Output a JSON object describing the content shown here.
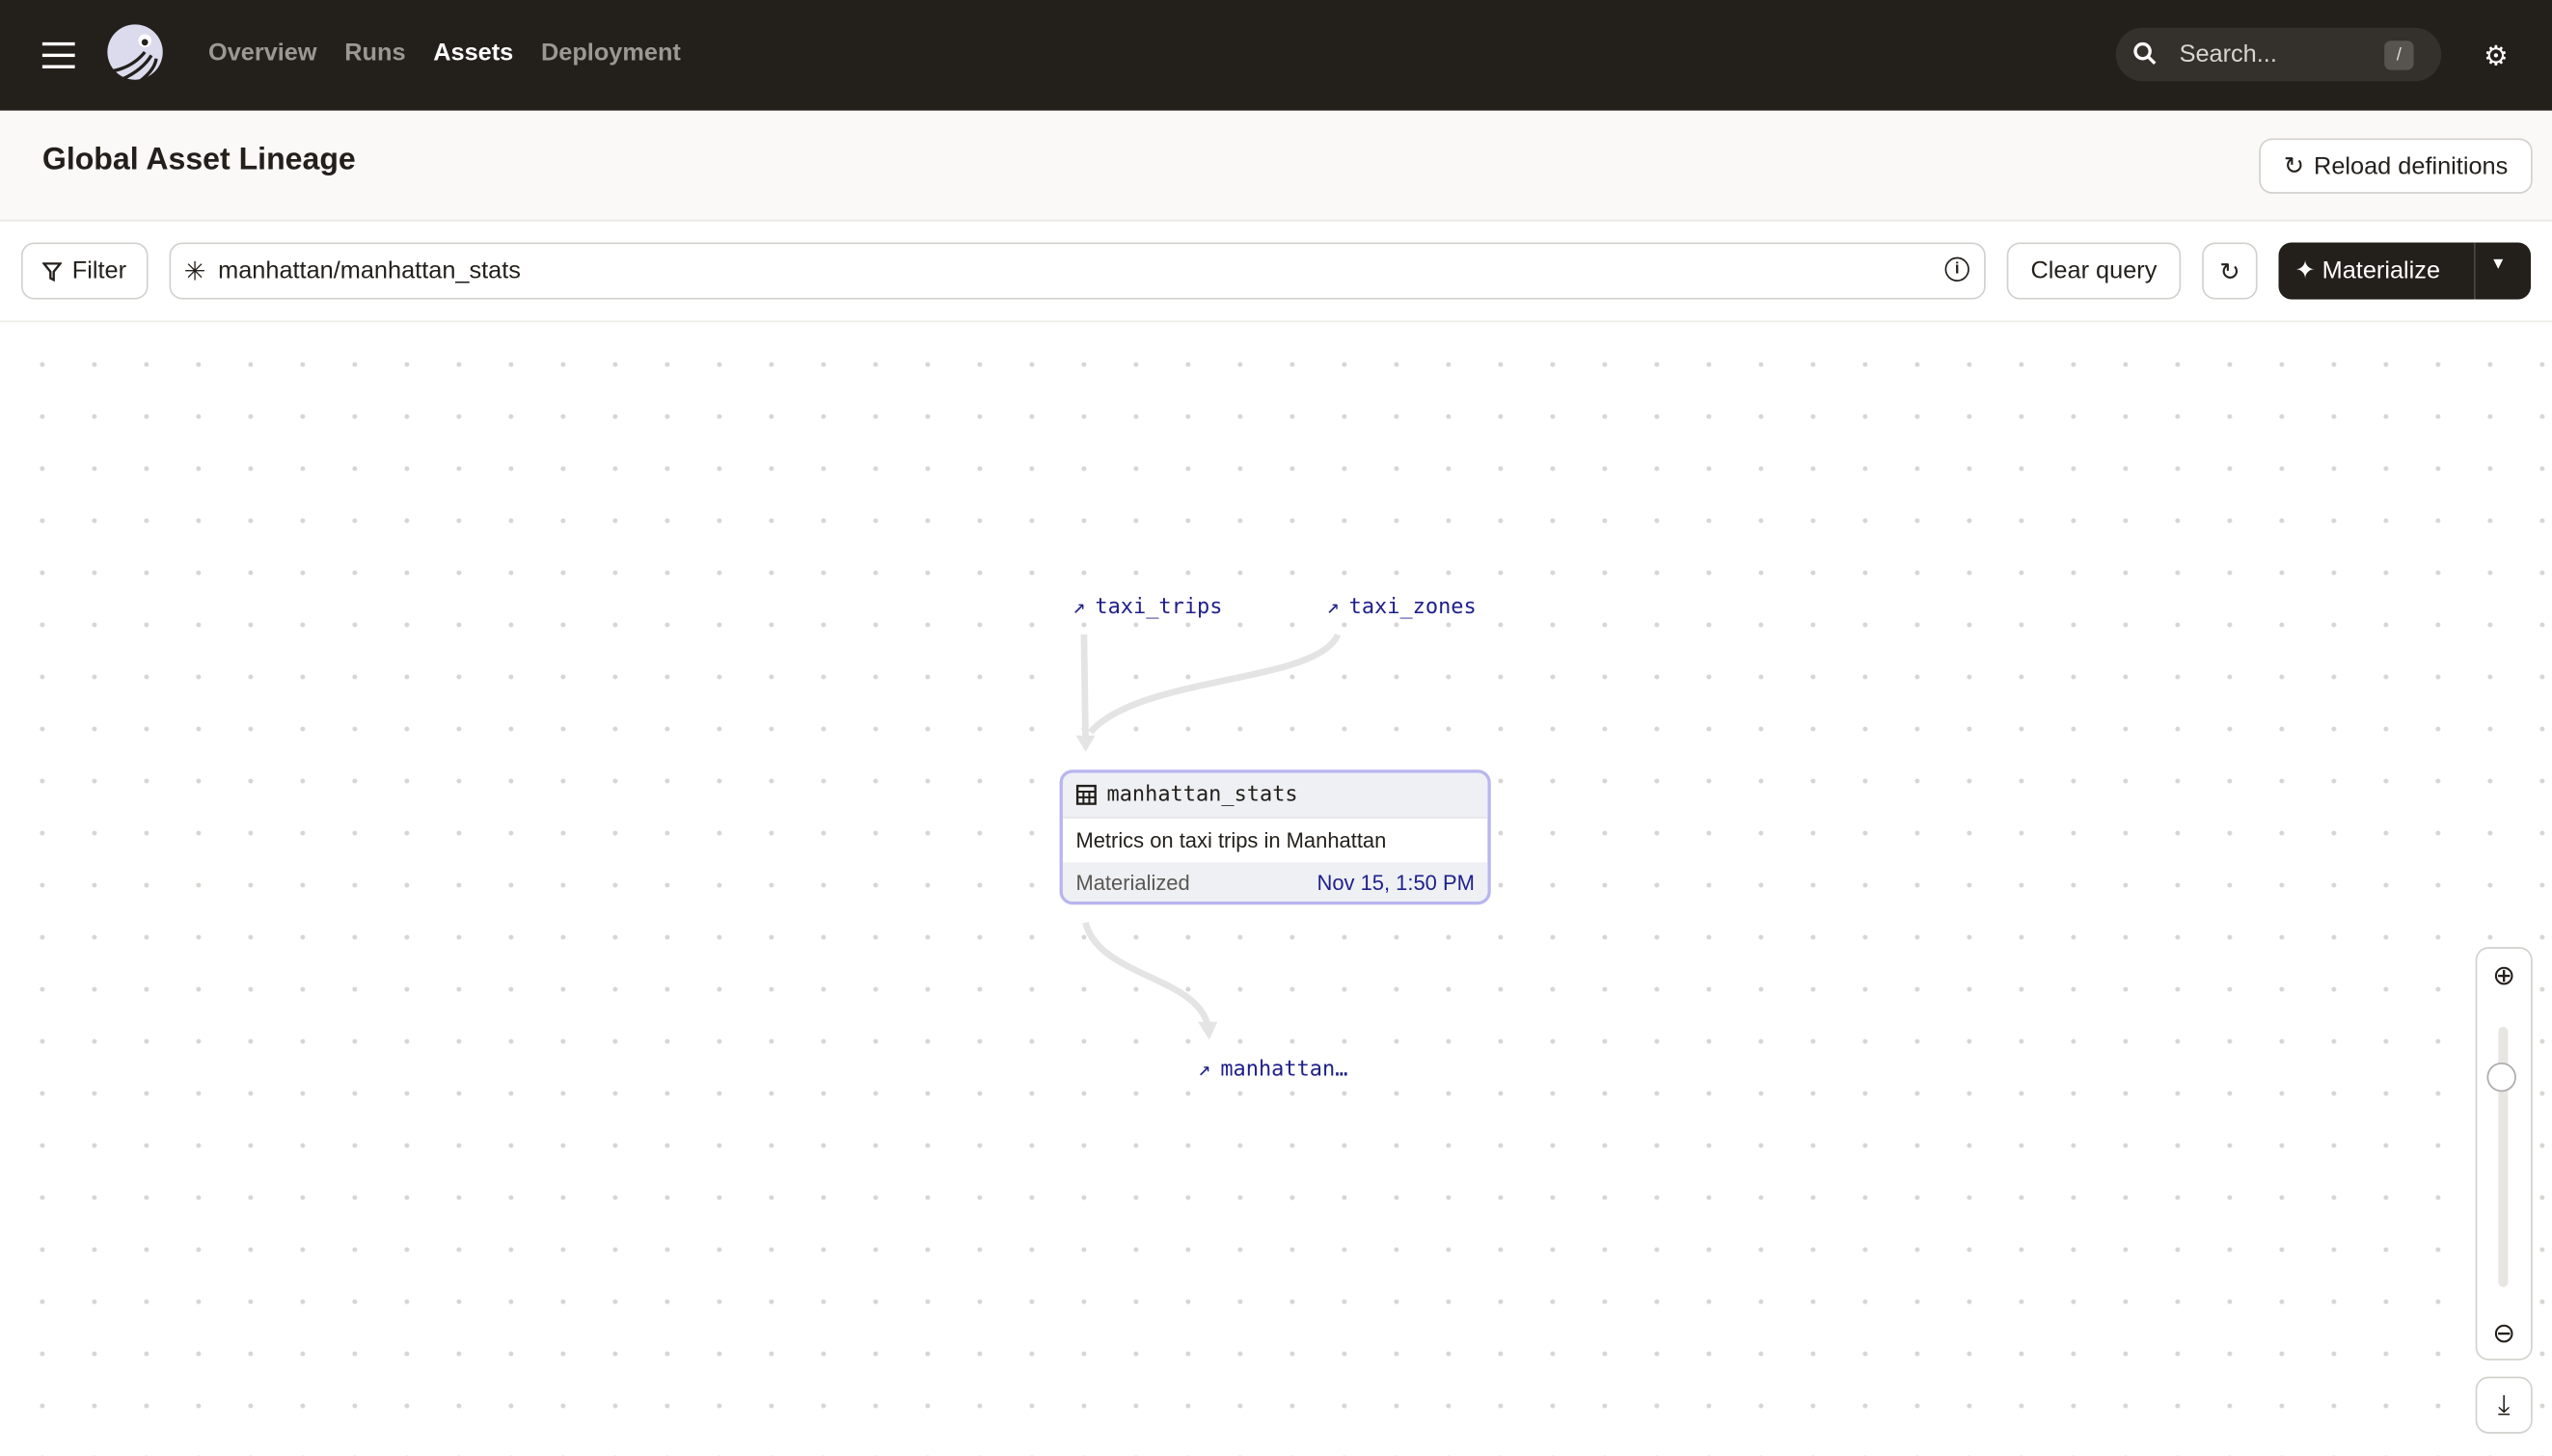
{
  "topbar": {
    "nav": [
      "Overview",
      "Runs",
      "Assets",
      "Deployment"
    ],
    "active": "Assets",
    "search_placeholder": "Search...",
    "search_shortcut": "/"
  },
  "header": {
    "title": "Global Asset Lineage",
    "reload_label": "Reload definitions"
  },
  "toolbar": {
    "filter_label": "Filter",
    "query_value": "manhattan/manhattan_stats",
    "clear_label": "Clear query",
    "materialize_label": "Materialize"
  },
  "graph": {
    "upstream": [
      "taxi_trips",
      "taxi_zones"
    ],
    "node": {
      "name": "manhattan_stats",
      "description": "Metrics on taxi trips in Manhattan",
      "status": "Materialized",
      "timestamp": "Nov 15, 1:50 PM"
    },
    "downstream": [
      "manhattan…"
    ]
  },
  "colors": {
    "topbar": "#231f1b",
    "link": "#1f1f8a",
    "node_border": "#b8b5ef"
  }
}
